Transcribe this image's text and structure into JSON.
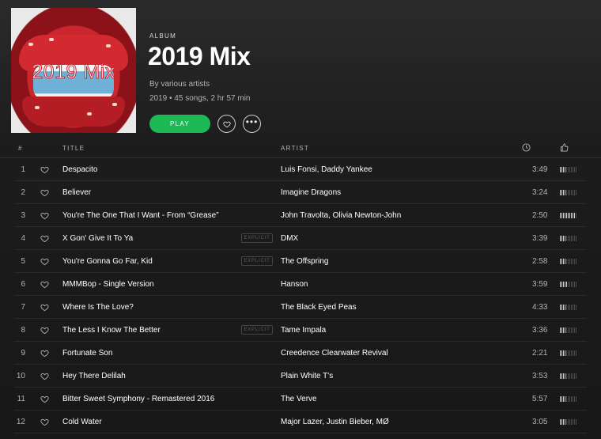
{
  "album": {
    "type_label": "ALBUM",
    "title": "2019 Mix",
    "cover_text": "2019 Mix",
    "byline": "By various artists",
    "meta": "2019 • 45 songs, 2 hr 57 min",
    "play_label": "PLAY",
    "like_icon": "heart-icon",
    "more_icon": "more-icon"
  },
  "columns": {
    "number": "#",
    "title": "TITLE",
    "artist": "ARTIST",
    "duration_icon": "clock-icon",
    "popularity_icon": "thumbs-up-icon"
  },
  "colors": {
    "accent": "#1db954",
    "background": "#181818",
    "text_secondary": "#b3b3b3"
  },
  "tracks": [
    {
      "num": "1",
      "title": "Despacito",
      "explicit": "",
      "artist": "Luis Fonsi, Daddy Yankee",
      "duration": "3:49",
      "popularity": 0.36
    },
    {
      "num": "2",
      "title": "Believer",
      "explicit": "",
      "artist": "Imagine Dragons",
      "duration": "3:24",
      "popularity": 0.36
    },
    {
      "num": "3",
      "title": "You're The One That I Want - From “Grease”",
      "explicit": "",
      "artist": "John Travolta, Olivia Newton-John",
      "duration": "2:50",
      "popularity": 0.9
    },
    {
      "num": "4",
      "title": "X Gon' Give It To Ya",
      "explicit": "EXPLICIT",
      "artist": "DMX",
      "duration": "3:39",
      "popularity": 0.36
    },
    {
      "num": "5",
      "title": "You're Gonna Go Far, Kid",
      "explicit": "EXPLICIT",
      "artist": "The Offspring",
      "duration": "2:58",
      "popularity": 0.36
    },
    {
      "num": "6",
      "title": "MMMBop - Single Version",
      "explicit": "",
      "artist": "Hanson",
      "duration": "3:59",
      "popularity": 0.45
    },
    {
      "num": "7",
      "title": "Where Is The Love?",
      "explicit": "",
      "artist": "The Black Eyed Peas",
      "duration": "4:33",
      "popularity": 0.36
    },
    {
      "num": "8",
      "title": "The Less I Know The Better",
      "explicit": "EXPLICIT",
      "artist": "Tame Impala",
      "duration": "3:36",
      "popularity": 0.36
    },
    {
      "num": "9",
      "title": "Fortunate Son",
      "explicit": "",
      "artist": "Creedence Clearwater Revival",
      "duration": "2:21",
      "popularity": 0.36
    },
    {
      "num": "10",
      "title": "Hey There Delilah",
      "explicit": "",
      "artist": "Plain White T's",
      "duration": "3:53",
      "popularity": 0.36
    },
    {
      "num": "11",
      "title": "Bitter Sweet Symphony - Remastered 2016",
      "explicit": "",
      "artist": "The Verve",
      "duration": "5:57",
      "popularity": 0.36
    },
    {
      "num": "12",
      "title": "Cold Water",
      "explicit": "",
      "artist": "Major Lazer, Justin Bieber, MØ",
      "duration": "3:05",
      "popularity": 0.36
    }
  ]
}
